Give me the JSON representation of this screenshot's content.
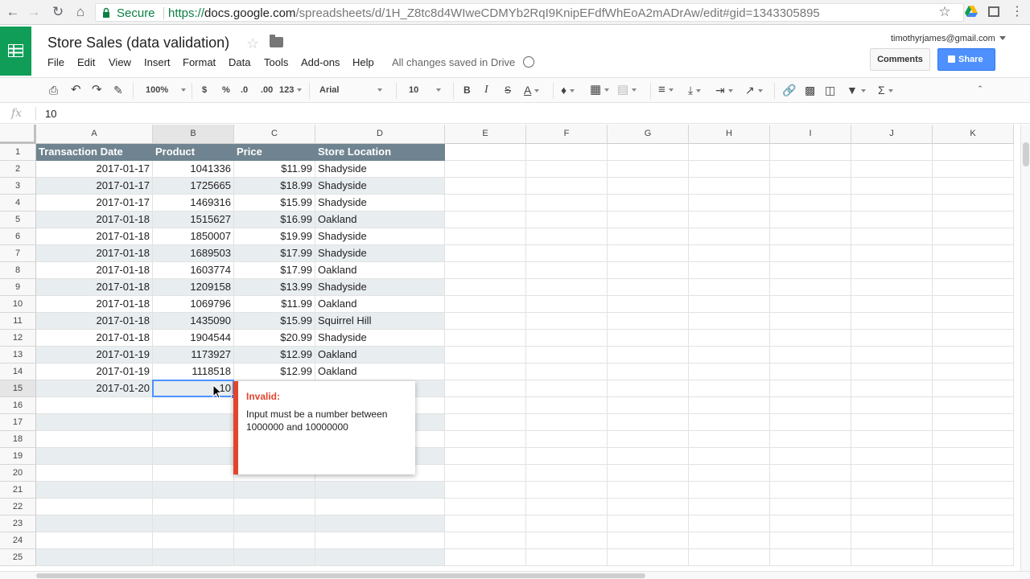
{
  "browser": {
    "secure_label": "Secure",
    "url_scheme": "https://",
    "url_domain": "docs.google.com",
    "url_path": "/spreadsheets/d/1H_Z8tc8d4WIweCDMYb2RqI9KnipEFdfWhEoA2mADrAw/edit#gid=1343305895"
  },
  "doc": {
    "title": "Store Sales (data validation)",
    "menus": [
      "File",
      "Edit",
      "View",
      "Insert",
      "Format",
      "Data",
      "Tools",
      "Add-ons",
      "Help"
    ],
    "save_status": "All changes saved in Drive",
    "account": "timothyrjames@gmail.com",
    "comments_label": "Comments",
    "share_label": "Share"
  },
  "toolbar": {
    "zoom": "100%",
    "currency": "$",
    "percent": "%",
    "dec_less": ".0",
    "dec_more": ".00",
    "more_formats": "123",
    "font": "Arial",
    "font_size": "10",
    "bold": "B",
    "italic": "I",
    "strike": "S",
    "text_color": "A",
    "functions": "Σ"
  },
  "formula_bar": {
    "fx": "fx",
    "value": "10"
  },
  "columns": [
    "A",
    "B",
    "C",
    "D",
    "E",
    "F",
    "G",
    "H",
    "I",
    "J",
    "K"
  ],
  "row_numbers": [
    "1",
    "2",
    "3",
    "4",
    "5",
    "6",
    "7",
    "8",
    "9",
    "10",
    "11",
    "12",
    "13",
    "14",
    "15",
    "16",
    "17",
    "18",
    "19",
    "20",
    "21",
    "22",
    "23",
    "24",
    "25"
  ],
  "sheet": {
    "headers": [
      "Transaction Date",
      "Product",
      "Price",
      "Store Location"
    ],
    "rows": [
      [
        "2017-01-17",
        "1041336",
        "$11.99",
        "Shadyside"
      ],
      [
        "2017-01-17",
        "1725665",
        "$18.99",
        "Shadyside"
      ],
      [
        "2017-01-17",
        "1469316",
        "$15.99",
        "Shadyside"
      ],
      [
        "2017-01-18",
        "1515627",
        "$16.99",
        "Oakland"
      ],
      [
        "2017-01-18",
        "1850007",
        "$19.99",
        "Shadyside"
      ],
      [
        "2017-01-18",
        "1689503",
        "$17.99",
        "Shadyside"
      ],
      [
        "2017-01-18",
        "1603774",
        "$17.99",
        "Oakland"
      ],
      [
        "2017-01-18",
        "1209158",
        "$13.99",
        "Shadyside"
      ],
      [
        "2017-01-18",
        "1069796",
        "$11.99",
        "Oakland"
      ],
      [
        "2017-01-18",
        "1435090",
        "$15.99",
        "Squirrel Hill"
      ],
      [
        "2017-01-18",
        "1904544",
        "$20.99",
        "Shadyside"
      ],
      [
        "2017-01-19",
        "1173927",
        "$12.99",
        "Oakland"
      ],
      [
        "2017-01-19",
        "1118518",
        "$12.99",
        "Oakland"
      ],
      [
        "2017-01-20",
        "10",
        "",
        ""
      ]
    ]
  },
  "validation_tooltip": {
    "title": "Invalid:",
    "message": "Input must be a number between 1000000 and 10000000"
  },
  "colors": {
    "header_bg": "#6f8490",
    "band_bg": "#e8edf0",
    "error": "#e0452d",
    "selection": "#4d90fe"
  }
}
